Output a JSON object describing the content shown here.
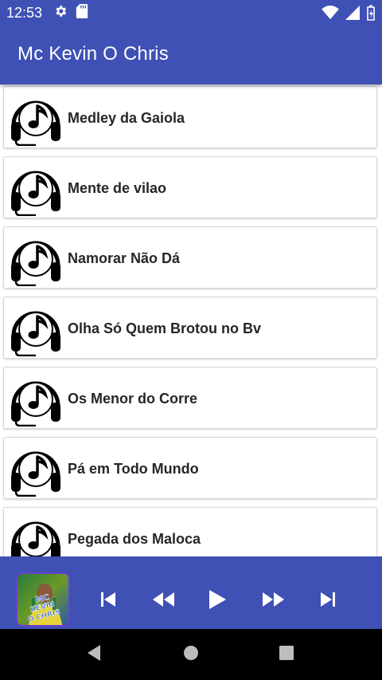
{
  "status_bar": {
    "time": "12:53",
    "icons_left": [
      "gear-icon",
      "sd-card-icon"
    ],
    "icons_right": [
      "wifi-icon",
      "signal-icon",
      "battery-icon"
    ]
  },
  "app_bar": {
    "title": "Mc Kevin O Chris"
  },
  "songs": [
    {
      "title": "Medley da Gaiola"
    },
    {
      "title": "Mente de vilao"
    },
    {
      "title": "Namorar Não Dá"
    },
    {
      "title": "Olha Só Quem Brotou no Bv"
    },
    {
      "title": "Os Menor do Corre"
    },
    {
      "title": "Pá em Todo Mundo"
    },
    {
      "title": "Pegada dos Maloca"
    }
  ],
  "player": {
    "album_art_text": "MC KEVIN O CHRIS",
    "controls": [
      "skip-previous-icon",
      "rewind-icon",
      "play-icon",
      "fast-forward-icon",
      "skip-next-icon"
    ]
  },
  "nav": [
    "back-icon",
    "home-icon",
    "recents-icon"
  ],
  "colors": {
    "primary": "#3f51b5",
    "text": "#262626",
    "nav_bar": "#000000"
  }
}
